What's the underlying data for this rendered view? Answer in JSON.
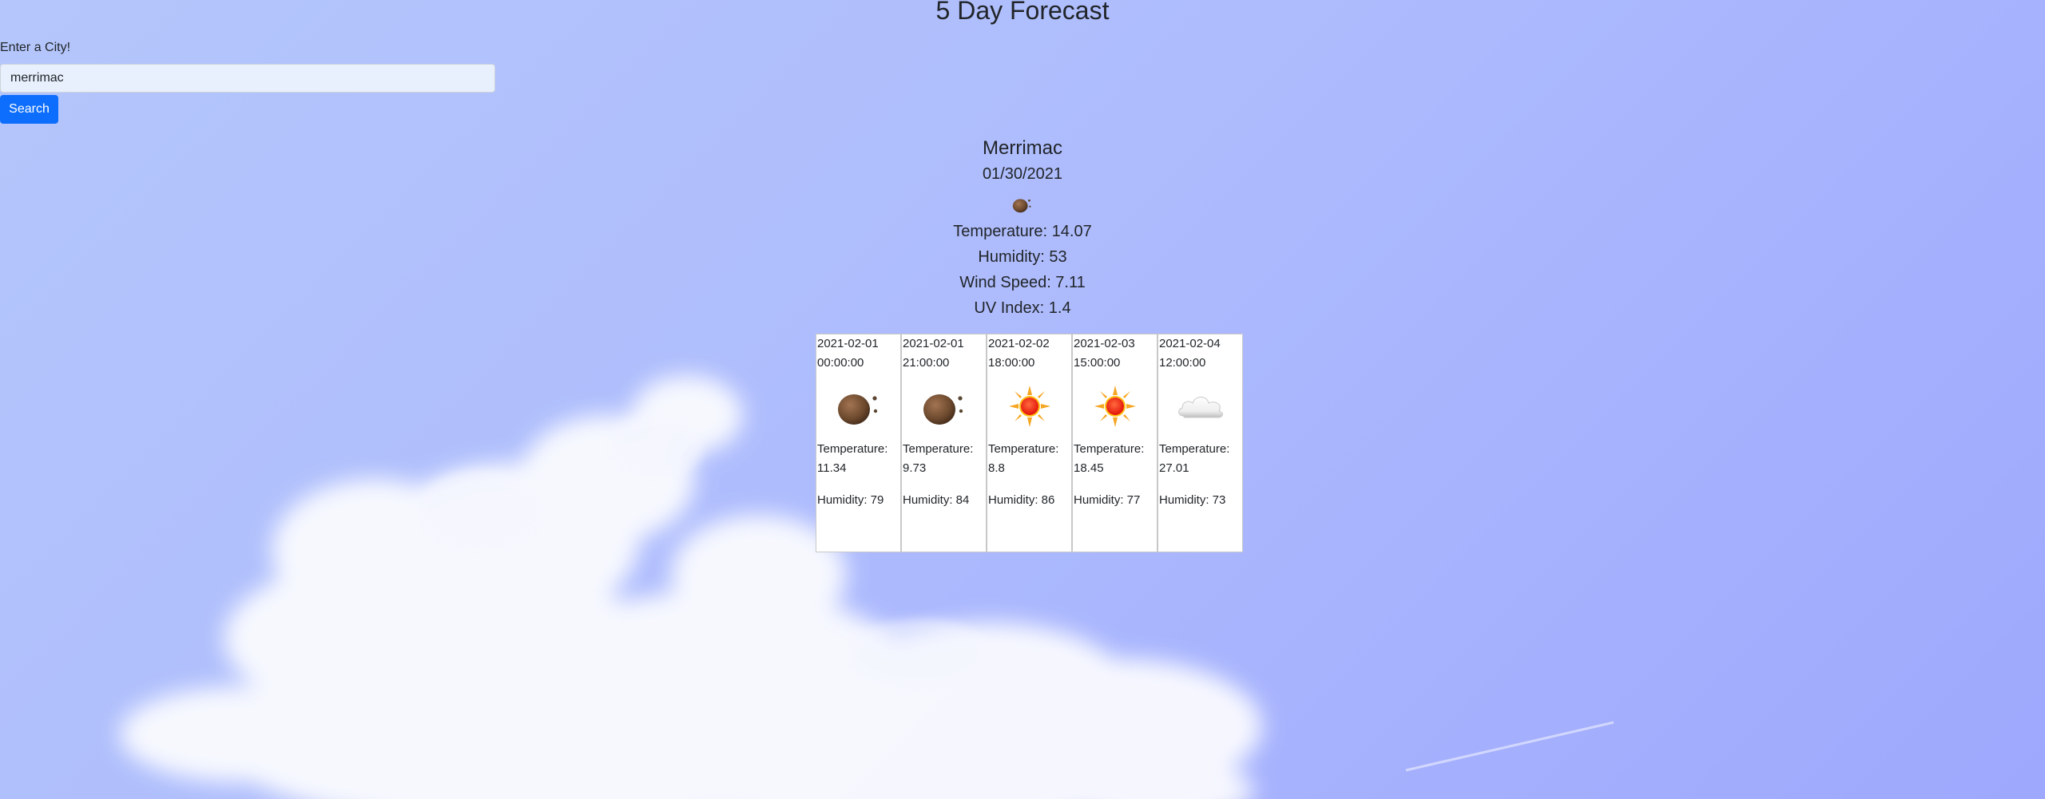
{
  "page": {
    "title": "5 Day Forecast"
  },
  "search": {
    "label": "Enter a City!",
    "value": "merrimac",
    "button_label": "Search"
  },
  "current": {
    "city": "Merrimac",
    "date": "01/30/2021",
    "icon": "night-clear-moon-icon",
    "temperature": "Temperature: 14.07",
    "humidity": "Humidity: 53",
    "wind_speed": "Wind Speed: 7.11",
    "uv_index": "UV Index: 1.4"
  },
  "forecast": [
    {
      "date_line1": "2021-02-01",
      "date_line2": "00:00:00",
      "icon": "night-clear-moon-icon",
      "temp_label": "Temperature:",
      "temp_value": "11.34",
      "humidity": "Humidity: 79"
    },
    {
      "date_line1": "2021-02-01",
      "date_line2": "21:00:00",
      "icon": "night-clear-moon-icon",
      "temp_label": "Temperature:",
      "temp_value": "9.73",
      "humidity": "Humidity: 84"
    },
    {
      "date_line1": "2021-02-02",
      "date_line2": "18:00:00",
      "icon": "clear-sun-icon",
      "temp_label": "Temperature:",
      "temp_value": "8.8",
      "humidity": "Humidity: 86"
    },
    {
      "date_line1": "2021-02-03",
      "date_line2": "15:00:00",
      "icon": "clear-sun-icon",
      "temp_label": "Temperature:",
      "temp_value": "18.45",
      "humidity": "Humidity: 77"
    },
    {
      "date_line1": "2021-02-04",
      "date_line2": "12:00:00",
      "icon": "cloud-icon",
      "temp_label": "Temperature:",
      "temp_value": "27.01",
      "humidity": "Humidity: 73"
    }
  ],
  "colors": {
    "primary_button": "#0d6efd",
    "input_background": "#e8f0fe",
    "sky_top": "#b4c6fb",
    "sky_right": "#9ea8fd"
  }
}
